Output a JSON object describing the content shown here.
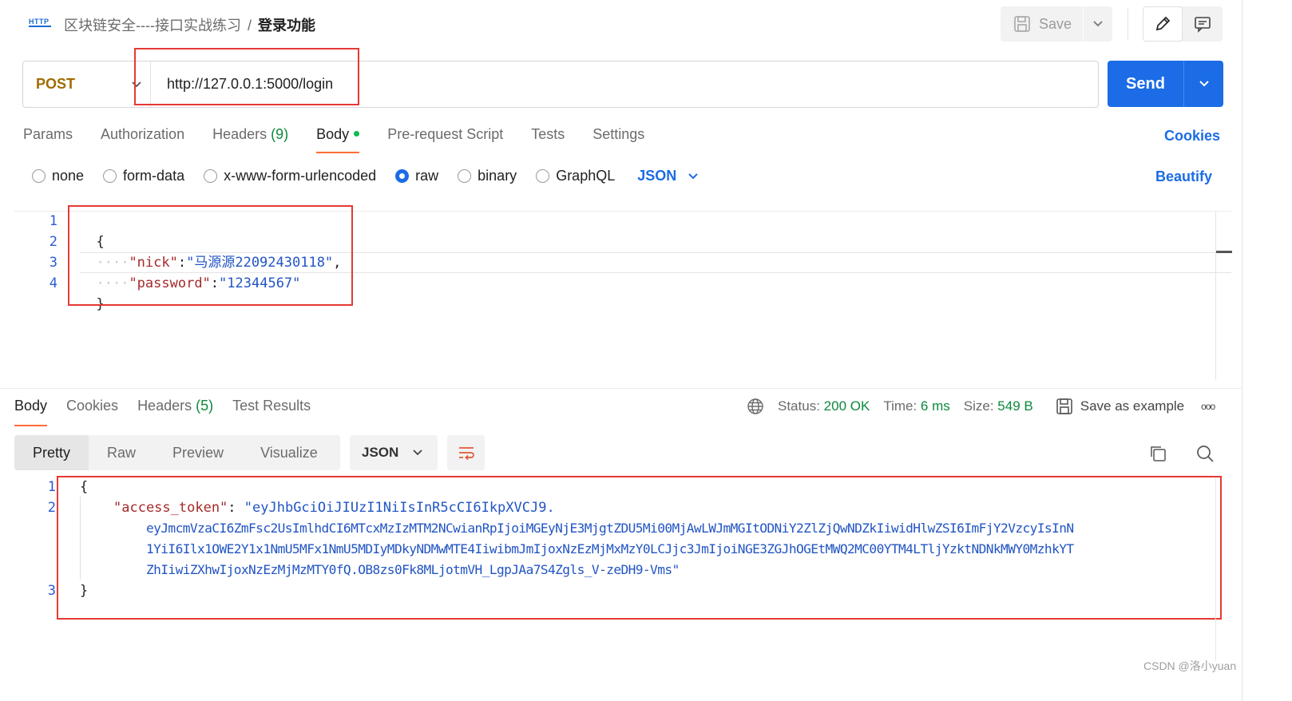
{
  "header": {
    "http_icon_label": "HTTP",
    "breadcrumb_parent": "区块链安全----接口实战练习",
    "breadcrumb_sep": "/",
    "breadcrumb_current": "登录功能",
    "save_label": "Save"
  },
  "request": {
    "method": "POST",
    "url": "http://127.0.0.1:5000/login",
    "send_label": "Send"
  },
  "req_tabs": {
    "params": "Params",
    "authorization": "Authorization",
    "headers": "Headers",
    "headers_count": "(9)",
    "body": "Body",
    "prerequest": "Pre-request Script",
    "tests": "Tests",
    "settings": "Settings",
    "cookies": "Cookies"
  },
  "body_types": {
    "none": "none",
    "form_data": "form-data",
    "urlencoded": "x-www-form-urlencoded",
    "raw": "raw",
    "binary": "binary",
    "graphql": "GraphQL",
    "format": "JSON",
    "beautify": "Beautify"
  },
  "request_body": {
    "line_numbers": [
      "1",
      "2",
      "3",
      "4"
    ],
    "open_brace": "{",
    "close_brace": "}",
    "indent_dots": "····",
    "nick_key": "\"nick\"",
    "nick_value": "\"马源源22092430118\"",
    "password_key": "\"password\"",
    "password_value": "\"12344567\"",
    "colon": ":",
    "comma": ","
  },
  "response": {
    "tabs": {
      "body": "Body",
      "cookies": "Cookies",
      "headers": "Headers",
      "headers_count": "(5)",
      "test_results": "Test Results"
    },
    "status_label": "Status:",
    "status_value": "200 OK",
    "time_label": "Time:",
    "time_value": "6 ms",
    "size_label": "Size:",
    "size_value": "549 B",
    "save_example": "Save as example",
    "more": "ooo",
    "views": {
      "pretty": "Pretty",
      "raw": "Raw",
      "preview": "Preview",
      "visualize": "Visualize"
    },
    "format": "JSON",
    "line_numbers": [
      "1",
      "2",
      "3"
    ],
    "open_brace": "{",
    "close_brace": "}",
    "token_key": "\"access_token\"",
    "colon": ": ",
    "token_line1": "\"eyJhbGciOiJIUzI1NiIsInR5cCI6IkpXVCJ9.",
    "token_line2": "eyJmcmVzaCI6ZmFsc2UsImlhdCI6MTcxMzIzMTM2NCwianRpIjoiMGEyNjE3MjgtZDU5Mi00MjAwLWJmMGItODNiY2ZlZjQwNDZkIiwidHlwZSI6ImFjY2VzcyIsInN",
    "token_line3": "1YiI6Ilx1OWE2Y1x1NmU5MFx1NmU5MDIyMDkyNDMwMTE4IiwibmJmIjoxNzEzMjMxMzY0LCJjc3JmIjoiNGE3ZGJhOGEtMWQ2MC00YTM4LTljYzktNDNkMWY0MzhkYT",
    "token_line4": "ZhIiwiZXhwIjoxNzEzMjMzMTY0fQ.OB8zs0Fk8MLjotmVH_LgpJAa7S4Zgls_V-zeDH9-Vms\""
  },
  "watermark": "CSDN @洛小yuan",
  "colors": {
    "accent": "#1b6ce6",
    "tab_indicator": "#ff6c37",
    "status_green": "#0b8a3c",
    "method_color": "#a06d00",
    "highlight_box": "#e53935"
  }
}
